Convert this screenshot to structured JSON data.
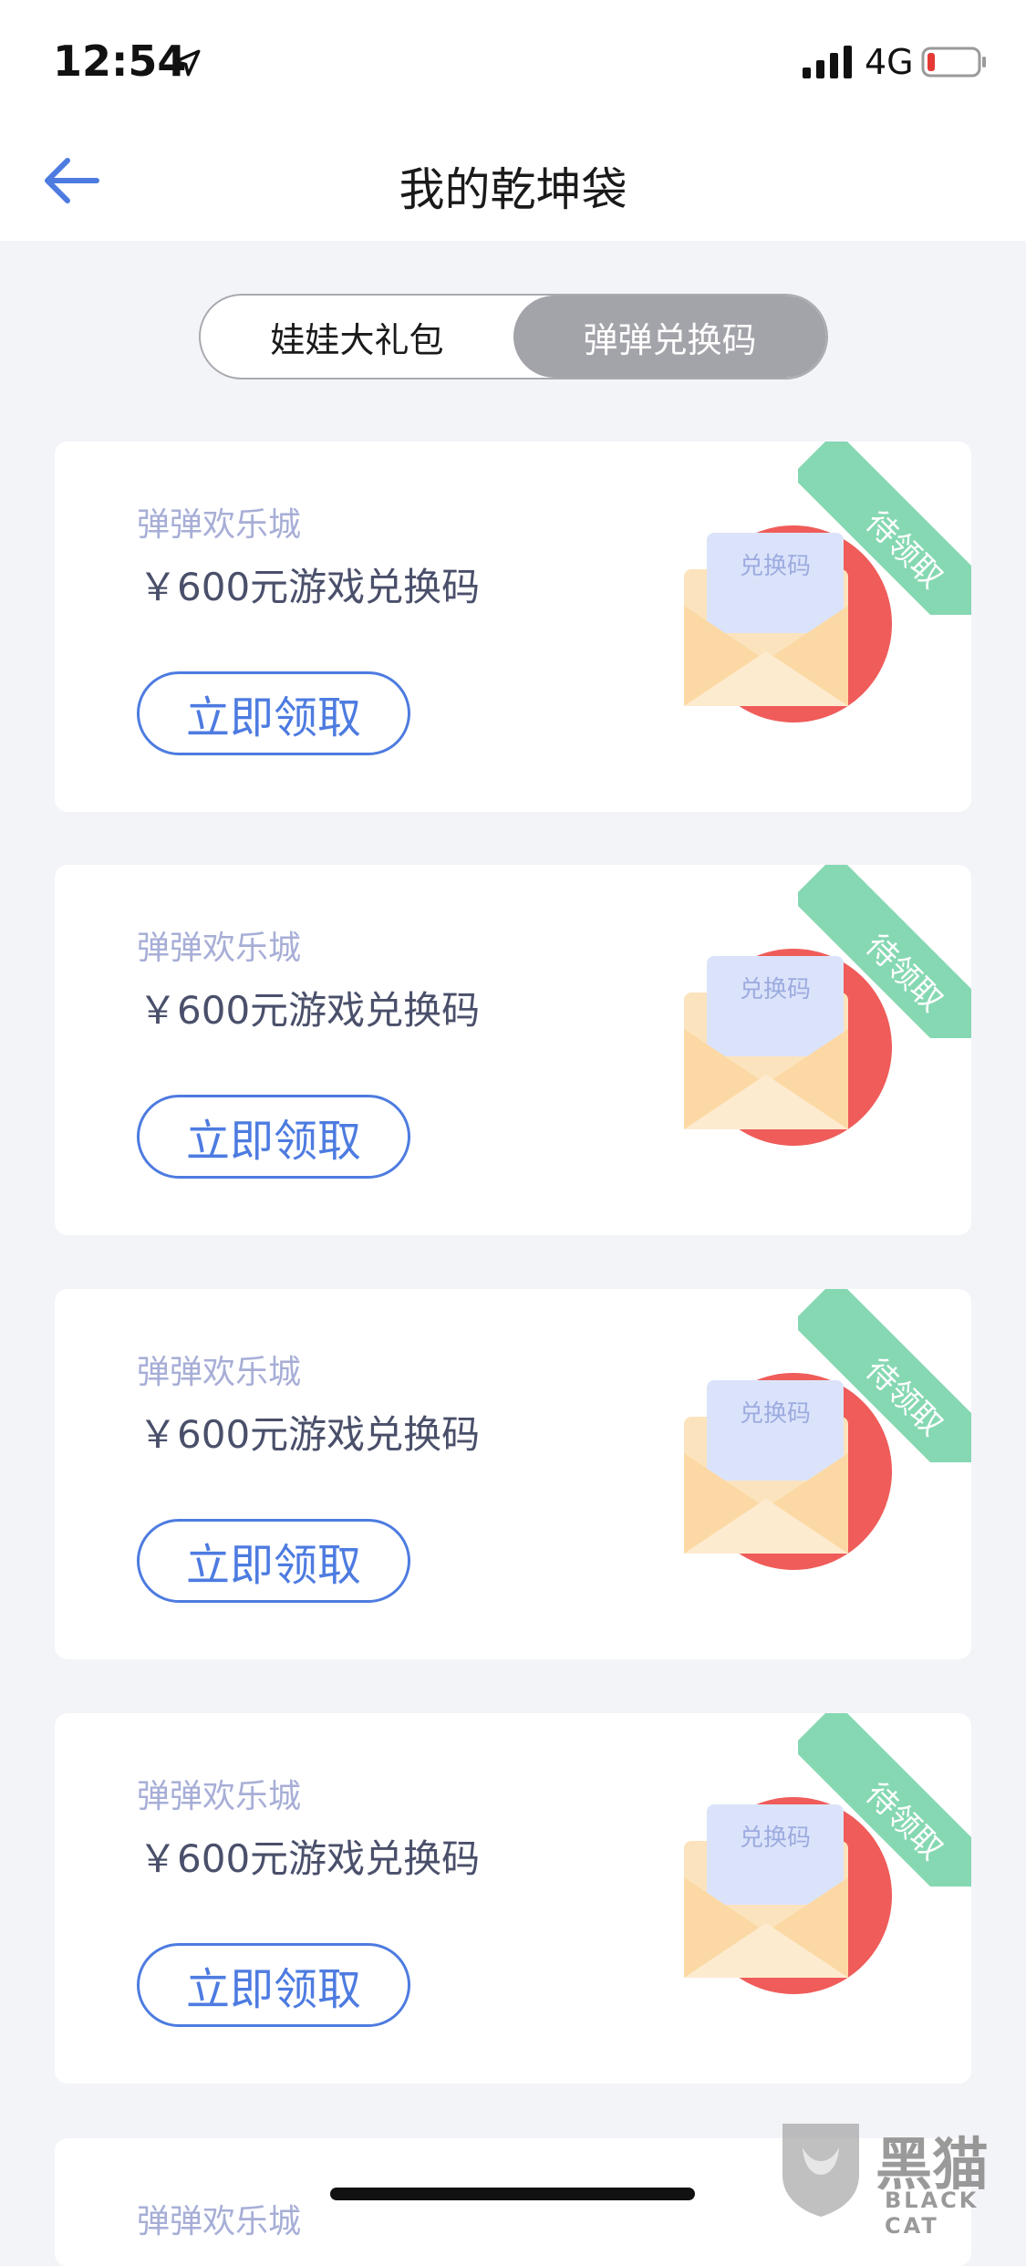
{
  "status_bar": {
    "time": "12:54",
    "network": "4G",
    "icons": [
      "location-arrow-icon",
      "signal-icon",
      "battery-low-icon"
    ]
  },
  "nav": {
    "title": "我的乾坤袋",
    "back_icon": "back-arrow-icon"
  },
  "tabs": [
    {
      "label": "娃娃大礼包",
      "active": false
    },
    {
      "label": "弹弹兑换码",
      "active": true
    }
  ],
  "cards": [
    {
      "brand": "弹弹欢乐城",
      "amount": "￥600元游戏兑换码",
      "button": "立即领取",
      "badge": "待领取",
      "envelope_label": "兑换码"
    },
    {
      "brand": "弹弹欢乐城",
      "amount": "￥600元游戏兑换码",
      "button": "立即领取",
      "badge": "待领取",
      "envelope_label": "兑换码"
    },
    {
      "brand": "弹弹欢乐城",
      "amount": "￥600元游戏兑换码",
      "button": "立即领取",
      "badge": "待领取",
      "envelope_label": "兑换码"
    },
    {
      "brand": "弹弹欢乐城",
      "amount": "￥600元游戏兑换码",
      "button": "立即领取",
      "badge": "待领取",
      "envelope_label": "兑换码"
    },
    {
      "brand": "弹弹欢乐城",
      "amount": "",
      "button": "",
      "badge": "",
      "envelope_label": ""
    }
  ],
  "watermark": {
    "text": "黑猫",
    "sub": "BLACK CAT"
  },
  "colors": {
    "accent": "#4d7be0",
    "badge": "#86d8b2",
    "brand_text": "#a7aed6",
    "envelope_circle": "#ef5c5a"
  }
}
